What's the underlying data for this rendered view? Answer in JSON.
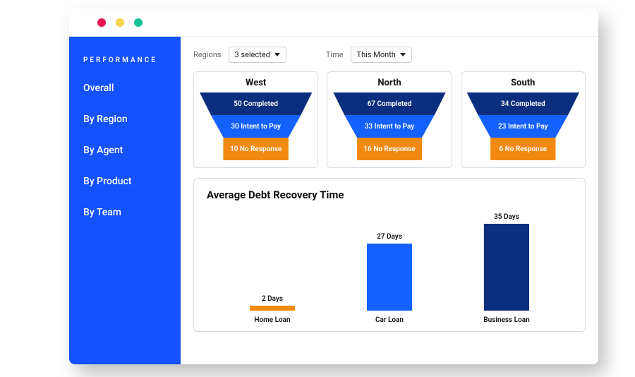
{
  "sidebar": {
    "title": "PERFORMANCE",
    "items": [
      "Overall",
      "By Region",
      "By Agent",
      "By Product",
      "By Team"
    ]
  },
  "filters": {
    "regions_label": "Regions",
    "regions_value": "3 selected",
    "time_label": "Time",
    "time_value": "This Month"
  },
  "funnels": [
    {
      "name": "West",
      "completed": "50 Completed",
      "intent": "30 Intent to Pay",
      "noresp": "10 No Response"
    },
    {
      "name": "North",
      "completed": "67 Completed",
      "intent": "33 Intent to Pay",
      "noresp": "16 No Response"
    },
    {
      "name": "South",
      "completed": "34 Completed",
      "intent": "23 Intent to Pay",
      "noresp": "6 No Response"
    }
  ],
  "chart_title": "Average Debt Recovery Time",
  "chart_data": {
    "type": "bar",
    "title": "Average Debt Recovery Time",
    "categories": [
      "Home Loan",
      "Car Loan",
      "Business Loan"
    ],
    "values": [
      2,
      27,
      35
    ],
    "value_labels": [
      "2 Days",
      "27 Days",
      "35 Days"
    ],
    "colors": [
      "#f28a12",
      "#1561ff",
      "#0b2e7e"
    ],
    "xlabel": "",
    "ylabel": "",
    "ylim": [
      0,
      40
    ]
  }
}
